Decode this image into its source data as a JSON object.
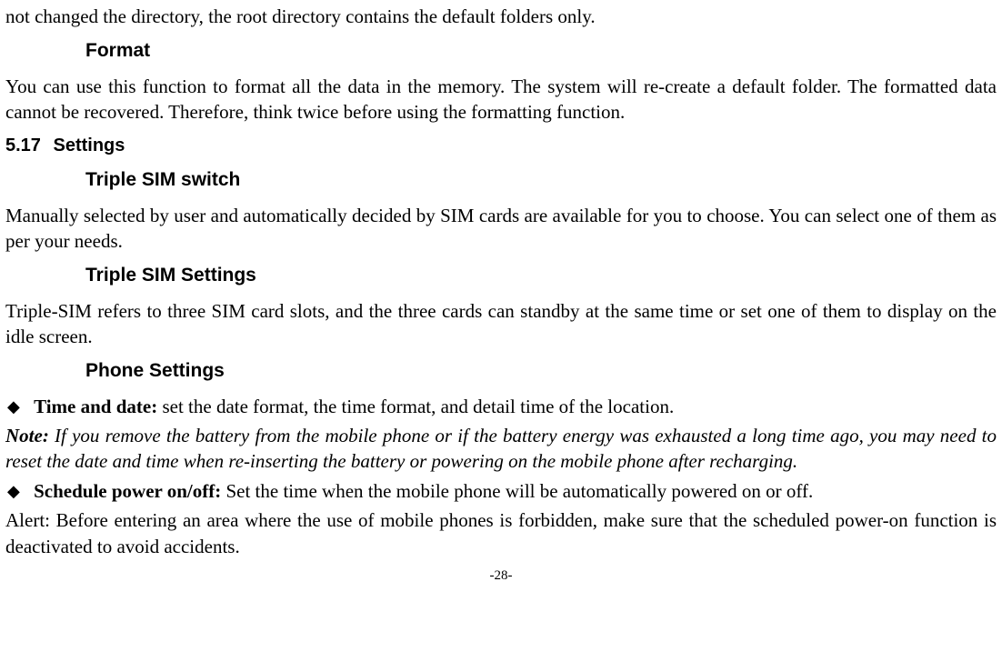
{
  "top_fragment": "not changed the directory, the root directory contains the default folders only.",
  "format": {
    "heading": "Format",
    "body": "You can use this function to format all the data in the memory. The system will re-create a default folder. The formatted data cannot be recovered. Therefore, think twice before using the formatting function."
  },
  "section": {
    "number": "5.17",
    "title": "Settings"
  },
  "triple_switch": {
    "heading": "Triple SIM switch",
    "body": "Manually selected by user and automatically decided by SIM cards are available for you to choose. You can select one of them as per your needs."
  },
  "triple_settings": {
    "heading": "Triple SIM Settings",
    "body": "Triple-SIM refers to three SIM card slots, and the three cards can standby at the same time or set one of them to display on the idle screen."
  },
  "phone_settings": {
    "heading": "Phone Settings",
    "items": [
      {
        "label": "Time and date:",
        "text": " set the date format, the time format, and detail time of the location."
      },
      {
        "label": "Schedule power on/off:",
        "text": " Set the time when the mobile phone will be automatically powered on or off."
      }
    ],
    "note_label": "Note:",
    "note_text": " If you remove the battery from the mobile phone or if the battery energy was exhausted a long time ago, you may need to reset the date and time when re-inserting the battery or powering on the mobile phone after recharging.",
    "alert": "Alert: Before entering an area where the use of mobile phones is forbidden, make sure that the scheduled power-on function is deactivated to avoid accidents."
  },
  "page_number": "-28-"
}
